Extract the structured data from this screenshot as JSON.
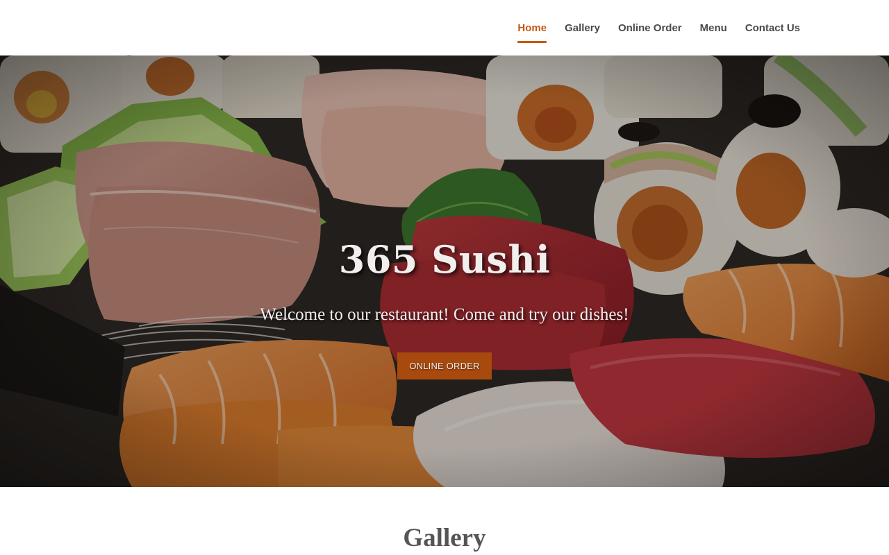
{
  "nav": {
    "items": [
      {
        "label": "Home",
        "active": true
      },
      {
        "label": "Gallery",
        "active": false
      },
      {
        "label": "Online Order",
        "active": false
      },
      {
        "label": "Menu",
        "active": false
      },
      {
        "label": "Contact Us",
        "active": false
      }
    ],
    "accent_color": "#c45a12",
    "text_color": "#4a4a4a"
  },
  "hero": {
    "title": "365 Sushi",
    "subtitle": "Welcome to our restaurant! Come and try our dishes!",
    "button_label": "ONLINE ORDER",
    "button_color": "#a84a0e",
    "background_image": "sushi-platter-photo"
  },
  "gallery": {
    "title": "Gallery"
  }
}
